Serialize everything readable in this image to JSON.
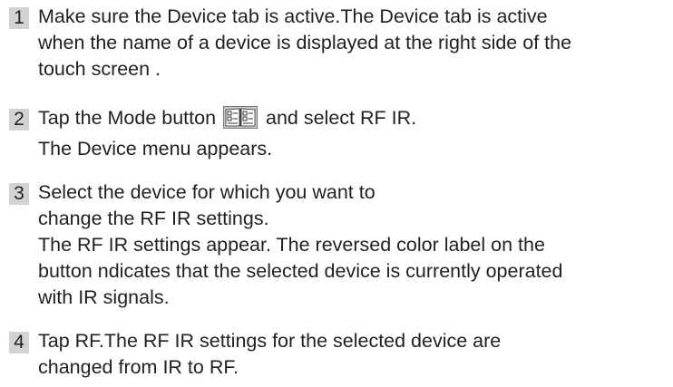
{
  "steps": [
    {
      "number": "1",
      "lines": [
        "Make sure the Device tab is active.The Device tab is active",
        "when the name of a device is displayed at the right side of the",
        "touch screen ."
      ]
    },
    {
      "number": "2",
      "line1_before": "Tap the Mode button",
      "line1_after": "and select RF IR.",
      "icon": "mode-book-icon",
      "line2": "The Device menu appears."
    },
    {
      "number": "3",
      "lines": [
        "Select the device for which you want to",
        "change the RF IR settings.",
        "The RF IR settings appear. The reversed color label on the",
        "button ndicates that the selected device is currently operated",
        "with IR signals."
      ]
    },
    {
      "number": "4",
      "lines": [
        "Tap RF.The RF IR settings for the selected device are",
        "changed from IR to RF."
      ]
    }
  ]
}
